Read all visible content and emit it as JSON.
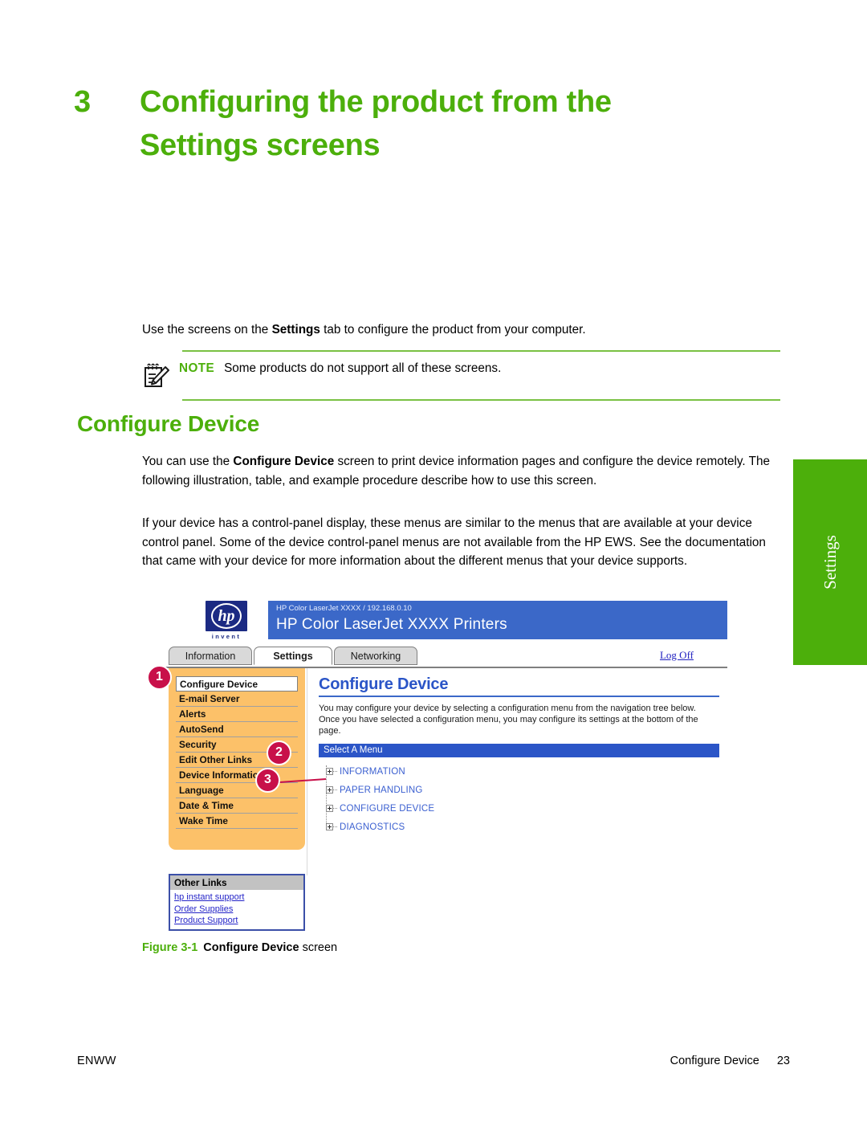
{
  "chapter": {
    "number": "3",
    "title": "Configuring the product from the Settings screens"
  },
  "intro": {
    "text_before": "Use the screens on the ",
    "bold": "Settings",
    "text_after": " tab to configure the product from your computer."
  },
  "note": {
    "icon": "note-pencil-icon",
    "label": "NOTE",
    "text": "Some products do not support all of these screens."
  },
  "section": {
    "heading": "Configure Device",
    "para1_before": "You can use the ",
    "para1_bold": "Configure Device",
    "para1_after": " screen to print device information pages and configure the device remotely. The following illustration, table, and example procedure describe how to use this screen.",
    "para2": "If your device has a control-panel display, these menus are similar to the menus that are available at your device control panel. Some of the device control-panel menus are not available from the HP EWS. See the documentation that came with your device for more information about the different menus that your device supports."
  },
  "side_tab": {
    "label": "Settings",
    "color": "#4caf0b"
  },
  "ews": {
    "logo": {
      "letters": "hp",
      "tagline": "invent"
    },
    "banner": {
      "subtitle": "HP Color LaserJet XXXX / 192.168.0.10",
      "title": "HP Color LaserJet XXXX Printers",
      "color": "#3b68c8"
    },
    "tabs": [
      {
        "label": "Information",
        "active": false
      },
      {
        "label": "Settings",
        "active": true
      },
      {
        "label": "Networking",
        "active": false
      }
    ],
    "logoff": "Log Off",
    "sidebar": {
      "background": "#fcc169",
      "items": [
        {
          "label": "Configure Device",
          "selected": true
        },
        {
          "label": "E-mail Server",
          "selected": false
        },
        {
          "label": "Alerts",
          "selected": false
        },
        {
          "label": "AutoSend",
          "selected": false
        },
        {
          "label": "Security",
          "selected": false
        },
        {
          "label": "Edit Other Links",
          "selected": false
        },
        {
          "label": "Device Information",
          "selected": false
        },
        {
          "label": "Language",
          "selected": false
        },
        {
          "label": "Date & Time",
          "selected": false
        },
        {
          "label": "Wake Time",
          "selected": false
        }
      ]
    },
    "content": {
      "title": "Configure Device",
      "description": "You may configure your device by selecting a configuration menu from the navigation tree below. Once you have selected a configuration menu, you may configure its settings at the bottom of the page.",
      "select_menu_label": "Select A Menu",
      "tree": [
        {
          "label": "INFORMATION",
          "expander": "plus-box-icon"
        },
        {
          "label": "PAPER HANDLING",
          "expander": "plus-box-icon"
        },
        {
          "label": "CONFIGURE DEVICE",
          "expander": "plus-box-icon"
        },
        {
          "label": "DIAGNOSTICS",
          "expander": "plus-box-icon"
        }
      ]
    },
    "other_links": {
      "header": "Other Links",
      "links": [
        "hp instant support",
        "Order Supplies",
        "Product Support"
      ]
    },
    "callouts": [
      {
        "number": "1"
      },
      {
        "number": "2"
      },
      {
        "number": "3"
      }
    ]
  },
  "figure": {
    "label": "Figure 3-1",
    "title_bold": "Configure Device",
    "title_rest": " screen"
  },
  "footer": {
    "left": "ENWW",
    "section": "Configure Device",
    "page": "23"
  }
}
